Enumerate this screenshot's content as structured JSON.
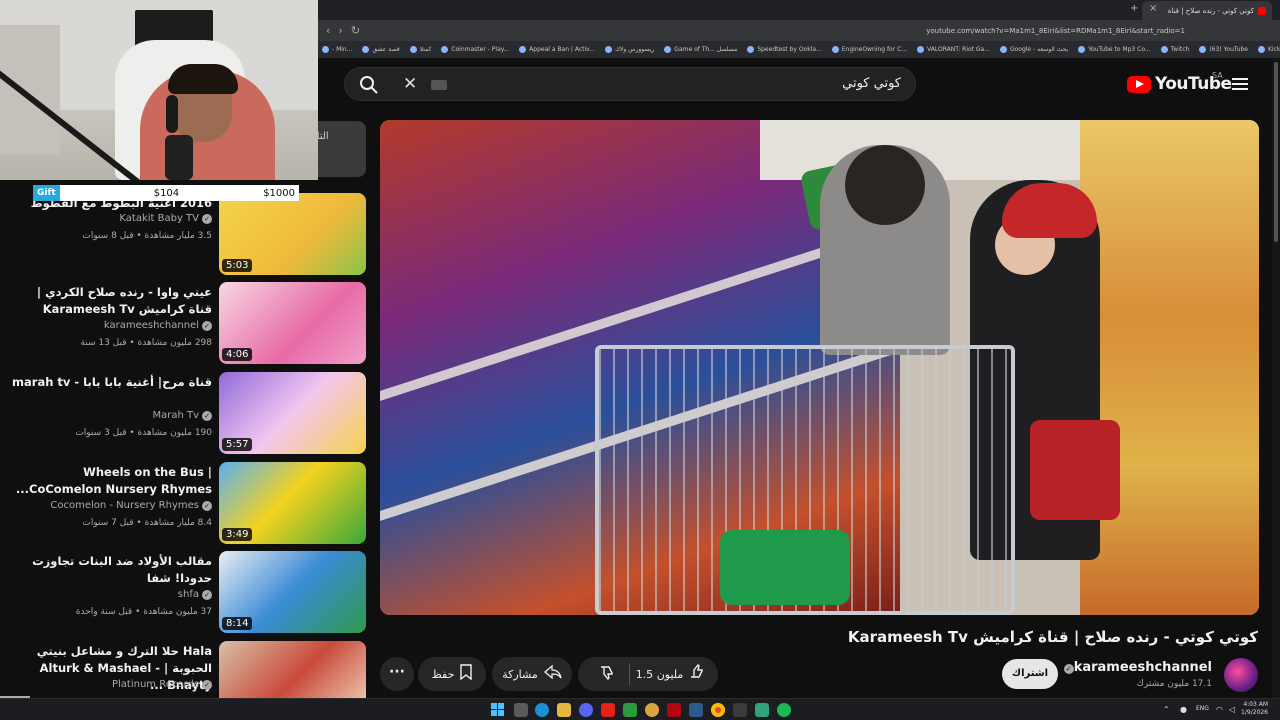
{
  "browser": {
    "active_tab_title": "كوتي كوتي - رنده صلاح | قناة",
    "url": "youtube.com/watch?v=Ma1m1_8Eiri&list=RDMa1m1_8Eiri&start_radio=1",
    "bookmarks": [
      "- Min...",
      "قصة عشق",
      "كمثلا",
      "Coinmaster - Play...",
      "Appeal a Ban | Activ...",
      "ریسوورس ولاك",
      "Game of Th... مسلسل",
      "Speedtest by Ookla...",
      "EngineOwning for C...",
      "VALORANT: Riot Ga...",
      "Google - بحث الوسعه",
      "YouTube to Mp3 Co...",
      "Twitch",
      "(63) YouTube",
      "Kick",
      "Vercio.ro"
    ]
  },
  "stream_overlay": {
    "gift_label": "Gift",
    "gift_current": "$104",
    "gift_goal": "$1000",
    "top_card_text": "التالي: قنا"
  },
  "header": {
    "search_value": "كوتي كوتي",
    "logo_text": "YouTube",
    "region": "SA"
  },
  "recommendations": [
    {
      "title": "2016 اغنية البطوط مع القطوط",
      "channel": "Katakit Baby TV",
      "meta": "3.5 مليار مشاهدة • قبل 8 سنوات",
      "duration": "5:03"
    },
    {
      "title": "عيني واوا - رنده صلاح الكردي | قناة كراميش Karameesh Tv",
      "channel": "karameeshchannel",
      "meta": "298 مليون مشاهدة • قبل 13 سنة",
      "duration": "4:06"
    },
    {
      "title": "قناة مرح| أغنية بابا بابا - marah tv",
      "channel": "Marah Tv",
      "meta": "190 مليون مشاهدة • قبل 3 سنوات",
      "duration": "5:57"
    },
    {
      "title": "Wheels on the Bus | CoComelon Nursery Rhymes...",
      "channel": "Cocomelon - Nursery Rhymes",
      "meta": "8.4 مليار مشاهدة • قبل 7 سنوات",
      "duration": "3:49"
    },
    {
      "title": "مقالب الأولاد ضد البنات تجاوزت حدودا! شفا",
      "channel": "shfa",
      "meta": "37 مليون مشاهدة • قبل سنة واحدة",
      "duration": "8:14"
    },
    {
      "title": "Hala حلا الترك و مشاعل بنيتي الحبوبة | Alturk & Mashael - Bnayty ...",
      "channel": "Platinum Records",
      "meta": "",
      "duration": ""
    }
  ],
  "video": {
    "title": "كوتي كوتي - رنده صلاح | قناة كراميش Karameesh Tv",
    "channel": "karameeshchannel",
    "subscribers": "17.1 مليون مشترك",
    "subscribe_label": "اشتراك",
    "likes": "1.5 مليون",
    "share_label": "مشاركة",
    "save_label": "حفظ"
  },
  "taskbar": {
    "lang": "ENG",
    "time": "4:03 AM",
    "date": "1/9/2026"
  },
  "colors": {
    "youtube_red": "#ff0000",
    "gift_blue": "#29a8e0",
    "background": "#0f0f0f"
  }
}
